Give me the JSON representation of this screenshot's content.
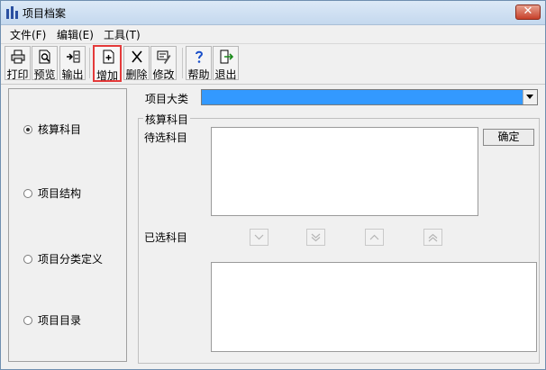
{
  "window": {
    "title": "项目档案"
  },
  "menu": [
    "文件(F)",
    "编辑(E)",
    "工具(T)"
  ],
  "toolbar": {
    "print": "打印",
    "preview": "预览",
    "export": "输出",
    "add": "增加",
    "delete": "删除",
    "modify": "修改",
    "help": "帮助",
    "exit": "退出"
  },
  "left_panel": {
    "options": [
      {
        "label": "核算科目",
        "selected": true
      },
      {
        "label": "项目结构",
        "selected": false
      },
      {
        "label": "项目分类定义",
        "selected": false
      },
      {
        "label": "项目目录",
        "selected": false
      }
    ]
  },
  "form": {
    "category_label": "项目大类",
    "category_value": "",
    "group_title": "核算科目",
    "candidate_label": "待选科目",
    "selected_label": "已选科目",
    "confirm_button": "确定"
  },
  "colors": {
    "highlight": "#e43a3a",
    "combo_fill": "#3399ff"
  }
}
